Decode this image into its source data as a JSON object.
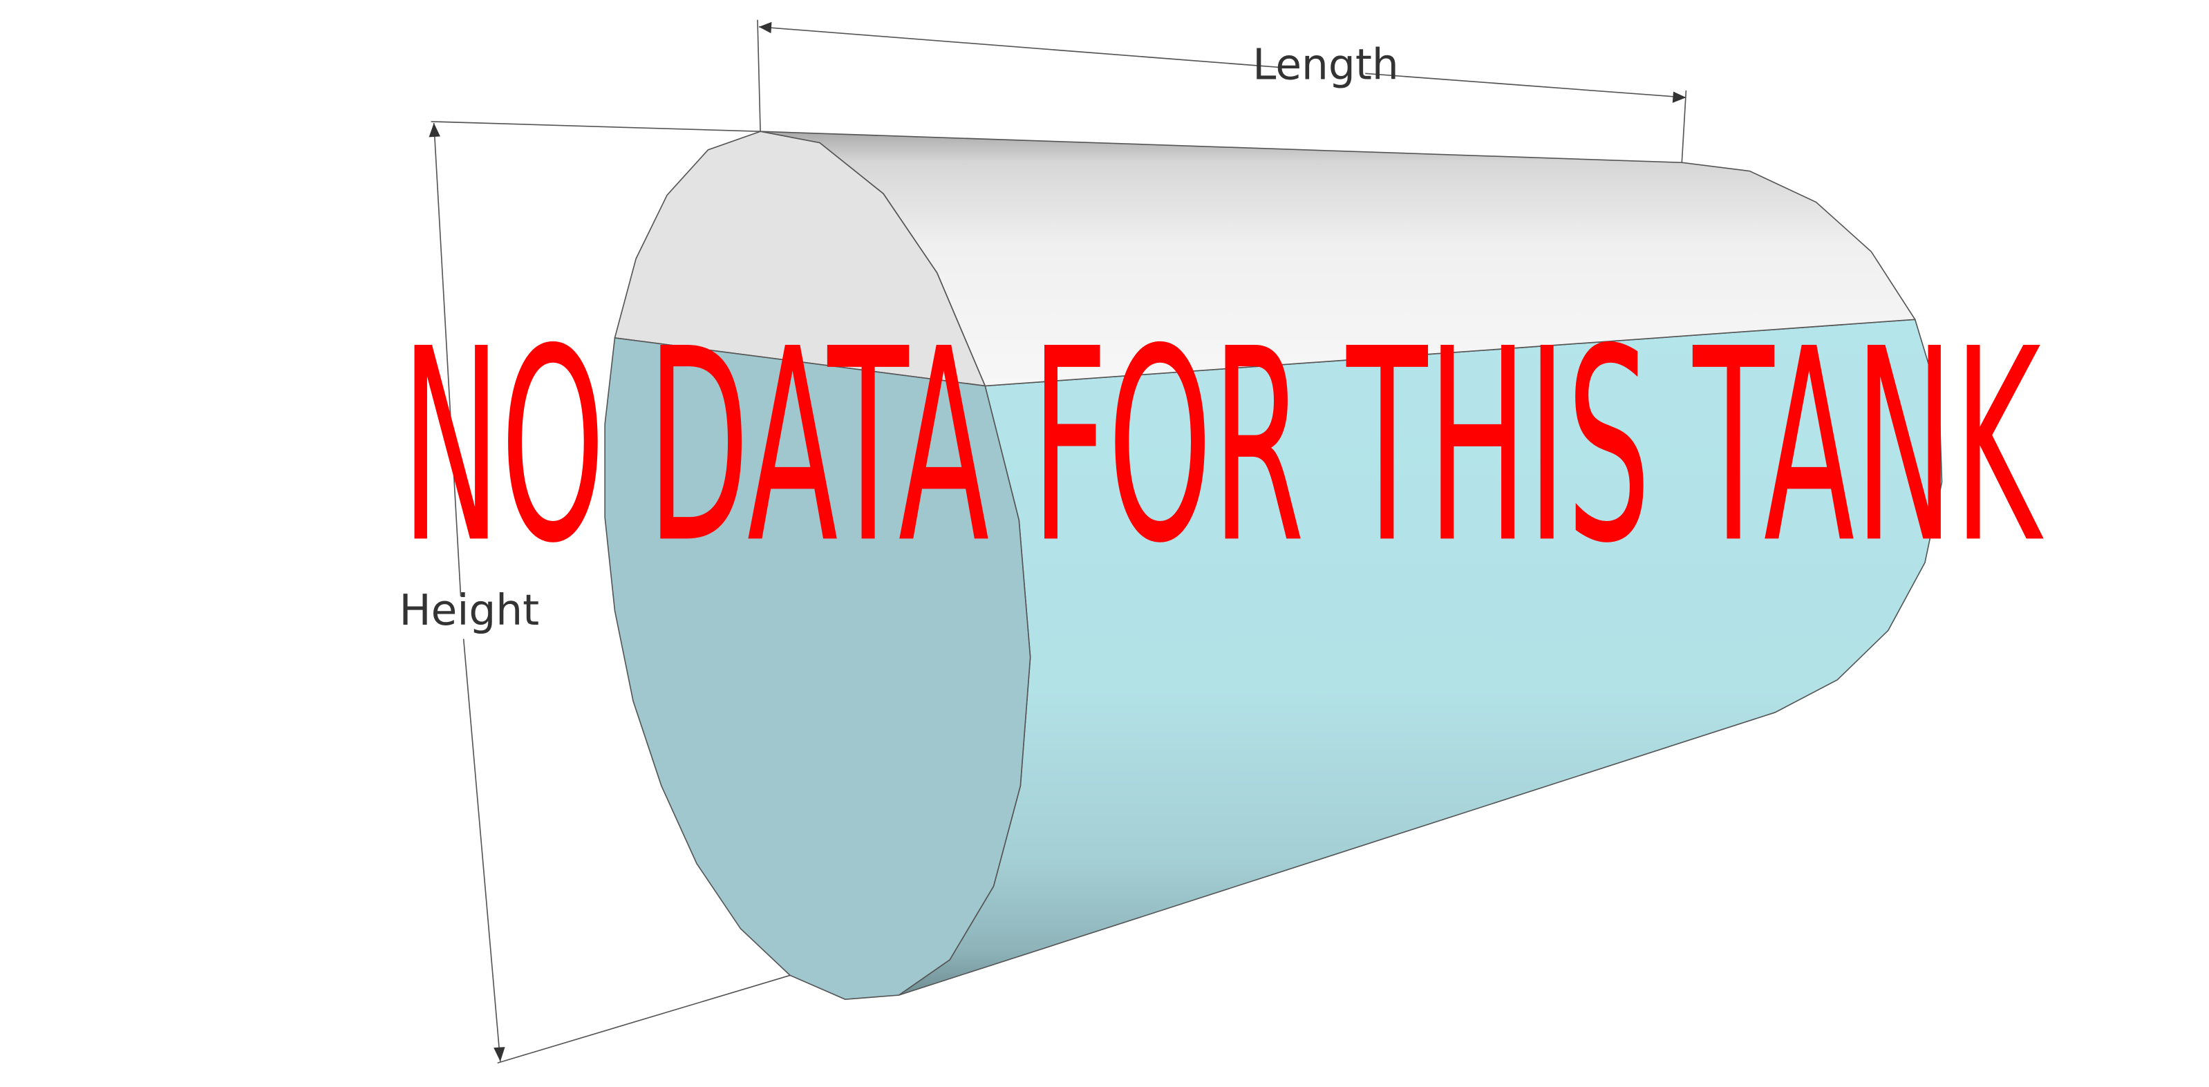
{
  "diagram": {
    "labels": {
      "length": "Length",
      "height": "Height"
    },
    "overlay_message": "NO DATA FOR THIS TANK",
    "colors": {
      "overlay_text": "#ff0000",
      "end_cap_top": "#e3e3e3",
      "end_cap_liquid": "#a0c7ce",
      "shell_top": "#f2f2f2",
      "shell_liquid": "#b4e5ea",
      "outline": "#555555",
      "dimension_line": "#555555",
      "background": "#ffffff"
    }
  }
}
